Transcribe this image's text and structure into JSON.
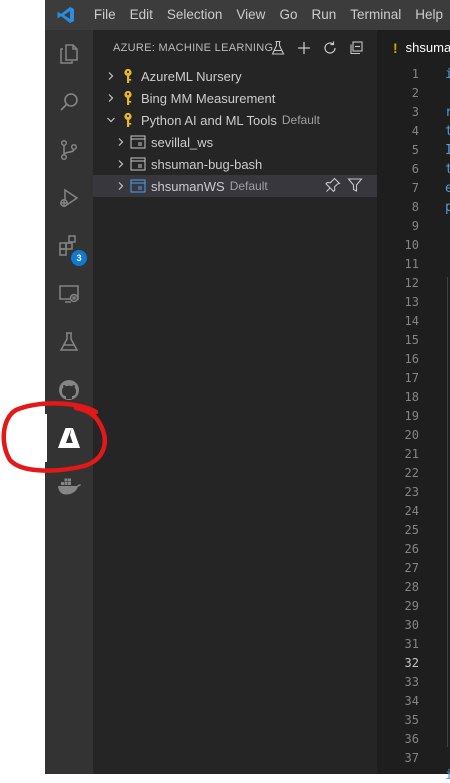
{
  "menu": [
    "File",
    "Edit",
    "Selection",
    "View",
    "Go",
    "Run",
    "Terminal",
    "Help"
  ],
  "activity_bar": {
    "items": [
      {
        "name": "explorer-icon"
      },
      {
        "name": "search-icon"
      },
      {
        "name": "source-control-icon"
      },
      {
        "name": "run-debug-icon"
      },
      {
        "name": "extensions-icon",
        "badge": "3"
      },
      {
        "name": "remote-explorer-icon"
      },
      {
        "name": "testing-flask-icon"
      },
      {
        "name": "github-icon"
      },
      {
        "name": "azure-icon",
        "active": true
      },
      {
        "name": "docker-icon"
      }
    ]
  },
  "sidebar": {
    "title": "AZURE: MACHINE LEARNING",
    "actions": [
      "flask-icon",
      "add-icon",
      "refresh-icon",
      "collapse-all-icon"
    ],
    "tree": [
      {
        "label": "AzureML Nursery",
        "desc": "",
        "level": 0,
        "expanded": false,
        "icon": "key-icon"
      },
      {
        "label": "Bing MM Measurement",
        "desc": "",
        "level": 0,
        "expanded": false,
        "icon": "key-icon"
      },
      {
        "label": "Python AI and ML Tools",
        "desc": "Default",
        "level": 0,
        "expanded": true,
        "icon": "key-icon"
      },
      {
        "label": "sevillal_ws",
        "desc": "",
        "level": 1,
        "expanded": false,
        "icon": "workspace-icon"
      },
      {
        "label": "shsuman-bug-bash",
        "desc": "",
        "level": 1,
        "expanded": false,
        "icon": "workspace-icon"
      },
      {
        "label": "shsumanWS",
        "desc": "Default",
        "level": 1,
        "expanded": false,
        "icon": "workspace-icon",
        "selected": true
      }
    ],
    "row_actions": [
      "pin-icon",
      "filter-icon"
    ]
  },
  "editor": {
    "tab_marker": "!",
    "tab_name": "shsuma",
    "line_numbers": [
      "1",
      "2",
      "3",
      "4",
      "5",
      "6",
      "7",
      "8",
      "9",
      "10",
      "11",
      "12",
      "13",
      "14",
      "15",
      "16",
      "17",
      "18",
      "19",
      "20",
      "21",
      "22",
      "23",
      "24",
      "25",
      "26",
      "27",
      "28",
      "29",
      "30",
      "31",
      "32",
      "33",
      "34",
      "35",
      "36",
      "37"
    ],
    "current_line": "32",
    "code_first_chars": [
      "i",
      "",
      "r",
      "t",
      "I",
      "t",
      "e",
      "p"
    ],
    "last_line_char": "i"
  },
  "colors": {
    "accent_blue": "#0e7ad3",
    "key_yellow": "#e8b923",
    "annotation_red": "#e31818"
  }
}
